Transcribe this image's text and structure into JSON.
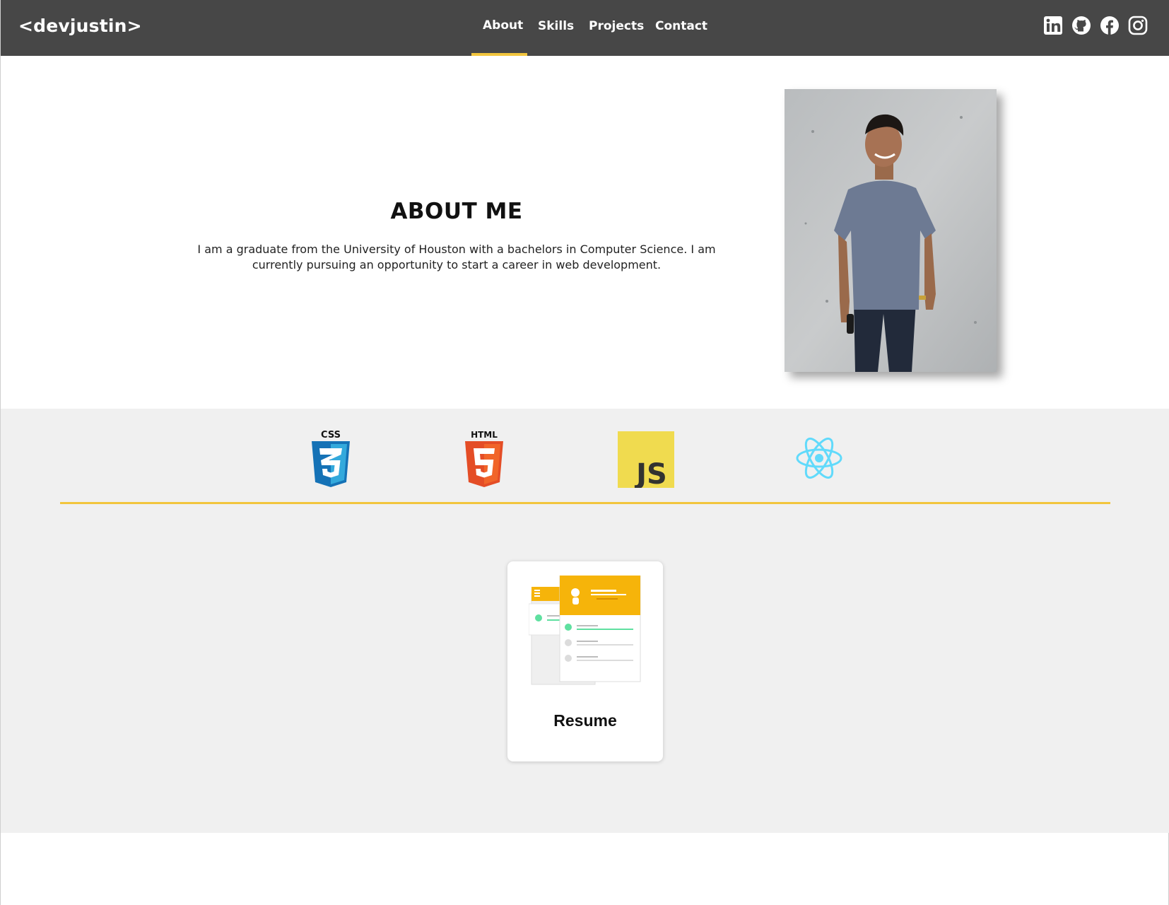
{
  "brand": {
    "logo": "<devjustin>"
  },
  "nav": {
    "items": [
      {
        "label": "About",
        "active": true
      },
      {
        "label": "Skills",
        "active": false
      },
      {
        "label": "Projects",
        "active": false
      },
      {
        "label": "Contact",
        "active": false
      }
    ],
    "active_indicator_color": "#f2c53d"
  },
  "social": [
    {
      "icon": "linkedin-icon"
    },
    {
      "icon": "github-icon"
    },
    {
      "icon": "facebook-icon"
    },
    {
      "icon": "instagram-icon"
    }
  ],
  "about": {
    "title": "ABOUT ME",
    "text": "I am a graduate from the University of Houston with a bachelors in Computer Science. I am currently pursuing an opportunity to start a career in web development.",
    "photo": "profile-photo"
  },
  "skills": [
    {
      "label": "CSS",
      "icon": "css3-icon"
    },
    {
      "label": "HTML",
      "icon": "html5-icon"
    },
    {
      "label": "JS",
      "icon": "javascript-icon"
    },
    {
      "icon": "react-icon"
    }
  ],
  "resume": {
    "label": "Resume",
    "icon": "resume-illustration"
  },
  "colors": {
    "navbar": "#474747",
    "accent": "#f2c53d",
    "section_bg": "#f0f0f0"
  }
}
